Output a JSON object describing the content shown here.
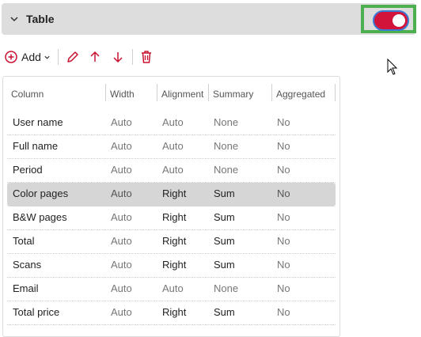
{
  "section": {
    "title": "Table",
    "toggle_on": true
  },
  "toolbar": {
    "add_label": "Add"
  },
  "table": {
    "columns": [
      "Column",
      "Width",
      "Alignment",
      "Summary",
      "Aggregated"
    ],
    "rows": [
      {
        "name": "User name",
        "width": "Auto",
        "alignment": "Auto",
        "summary": "None",
        "aggregated": "No",
        "selected": false
      },
      {
        "name": "Full name",
        "width": "Auto",
        "alignment": "Auto",
        "summary": "None",
        "aggregated": "No",
        "selected": false
      },
      {
        "name": "Period",
        "width": "Auto",
        "alignment": "Auto",
        "summary": "None",
        "aggregated": "No",
        "selected": false
      },
      {
        "name": "Color pages",
        "width": "Auto",
        "alignment": "Right",
        "summary": "Sum",
        "aggregated": "No",
        "selected": true
      },
      {
        "name": "B&W pages",
        "width": "Auto",
        "alignment": "Right",
        "summary": "Sum",
        "aggregated": "No",
        "selected": false
      },
      {
        "name": "Total",
        "width": "Auto",
        "alignment": "Right",
        "summary": "Sum",
        "aggregated": "No",
        "selected": false
      },
      {
        "name": "Scans",
        "width": "Auto",
        "alignment": "Right",
        "summary": "Sum",
        "aggregated": "No",
        "selected": false
      },
      {
        "name": "Email",
        "width": "Auto",
        "alignment": "Auto",
        "summary": "None",
        "aggregated": "No",
        "selected": false
      },
      {
        "name": "Total price",
        "width": "Auto",
        "alignment": "Right",
        "summary": "Sum",
        "aggregated": "No",
        "selected": false
      }
    ]
  },
  "colors": {
    "accent": "#c8102e",
    "toggle_on": "#d2143a",
    "highlight_border": "#4caf50",
    "selected_row": "#d6d6d6"
  },
  "icons": [
    "chevron-down-icon",
    "add-circle-icon",
    "caret-down-icon",
    "pencil-icon",
    "arrow-up-icon",
    "arrow-down-icon",
    "trash-icon",
    "mouse-cursor-icon"
  ]
}
